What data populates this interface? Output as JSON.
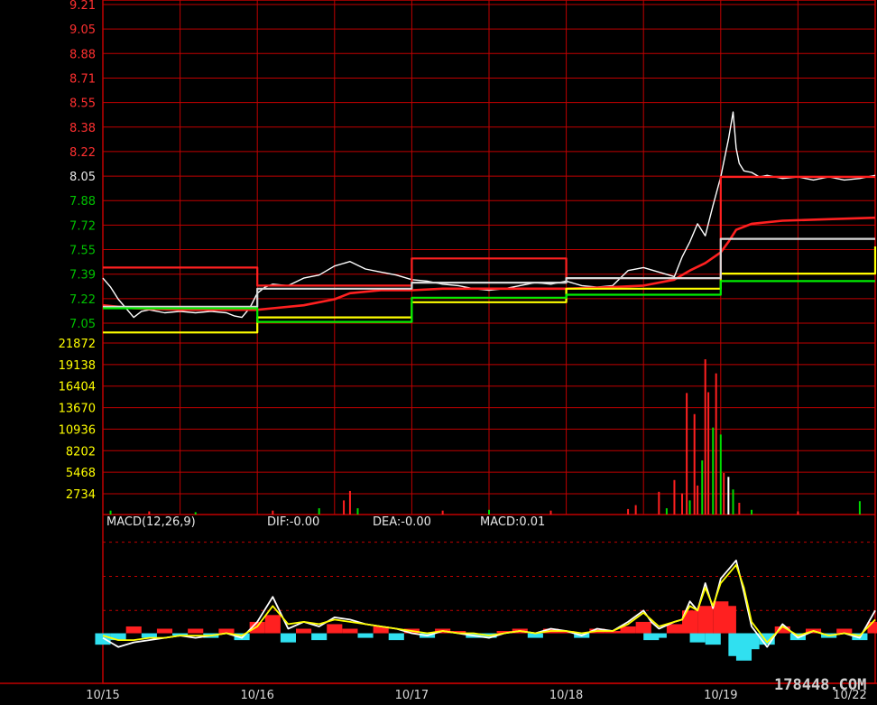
{
  "chart_data": [
    {
      "type": "line",
      "panel": "price",
      "ylim": [
        6.95,
        9.21
      ],
      "y_ticks": [
        "9.21",
        "9.05",
        "8.88",
        "8.71",
        "8.55",
        "8.38",
        "8.22",
        "8.05",
        "7.88",
        "7.72",
        "7.55",
        "7.39",
        "7.22",
        "7.05"
      ],
      "x_categories": [
        "10/15",
        "10/16",
        "10/17",
        "10/18",
        "10/19",
        "10/22"
      ],
      "series": [
        {
          "color": "#ffffff",
          "x": [
            0,
            0.05,
            0.1,
            0.15,
            0.2,
            0.25,
            0.3,
            0.4,
            0.5,
            0.6,
            0.7,
            0.8,
            0.85,
            0.9,
            0.95,
            1.0,
            1.05,
            1.1,
            1.2,
            1.3,
            1.4,
            1.5,
            1.6,
            1.7,
            1.8,
            1.9,
            2.0,
            2.1,
            2.2,
            2.3,
            2.4,
            2.5,
            2.6,
            2.7,
            2.8,
            2.9,
            3.0,
            3.1,
            3.2,
            3.3,
            3.4,
            3.5,
            3.6,
            3.7,
            3.75,
            3.8,
            3.85,
            3.9,
            3.95,
            4.0,
            4.05,
            4.08,
            4.1,
            4.12,
            4.15,
            4.2,
            4.25,
            4.3,
            4.4,
            4.5,
            4.6,
            4.7,
            4.8,
            4.9,
            5.0
          ],
          "values": [
            7.38,
            7.32,
            7.24,
            7.18,
            7.12,
            7.16,
            7.17,
            7.15,
            7.16,
            7.15,
            7.16,
            7.15,
            7.13,
            7.12,
            7.18,
            7.28,
            7.32,
            7.34,
            7.33,
            7.38,
            7.4,
            7.46,
            7.49,
            7.44,
            7.42,
            7.4,
            7.37,
            7.36,
            7.34,
            7.33,
            7.31,
            7.3,
            7.31,
            7.33,
            7.35,
            7.34,
            7.36,
            7.33,
            7.32,
            7.33,
            7.43,
            7.45,
            7.42,
            7.39,
            7.52,
            7.62,
            7.74,
            7.66,
            7.86,
            8.05,
            8.3,
            8.48,
            8.24,
            8.14,
            8.09,
            8.08,
            8.05,
            8.06,
            8.04,
            8.05,
            8.03,
            8.05,
            8.03,
            8.04,
            8.06
          ]
        },
        {
          "color": "#ff2020",
          "x": [
            0,
            0.2,
            0.5,
            0.8,
            1.0,
            1.1,
            1.3,
            1.5,
            1.6,
            1.8,
            2.0,
            2.2,
            2.5,
            2.8,
            3.0,
            3.3,
            3.5,
            3.7,
            3.8,
            3.9,
            4.0,
            4.05,
            4.1,
            4.2,
            4.4,
            4.7,
            5.0
          ],
          "values": [
            7.2,
            7.18,
            7.17,
            7.17,
            7.17,
            7.18,
            7.2,
            7.24,
            7.28,
            7.3,
            7.3,
            7.31,
            7.31,
            7.31,
            7.31,
            7.32,
            7.33,
            7.37,
            7.43,
            7.48,
            7.55,
            7.62,
            7.7,
            7.74,
            7.76,
            7.77,
            7.78
          ]
        },
        {
          "color": "#ffff00",
          "x": [
            0,
            1,
            1,
            2,
            2,
            3,
            3,
            4,
            4,
            5,
            5
          ],
          "values": [
            7.02,
            7.02,
            7.12,
            7.12,
            7.22,
            7.22,
            7.31,
            7.31,
            7.41,
            7.41,
            7.59
          ],
          "step": true
        },
        {
          "color": "#ff2020",
          "x": [
            0,
            1,
            1,
            2,
            2,
            3,
            3,
            4,
            4,
            5
          ],
          "values": [
            7.45,
            7.45,
            7.33,
            7.33,
            7.51,
            7.51,
            7.38,
            7.38,
            8.05,
            8.05
          ],
          "step": true
        },
        {
          "color": "#d8d8d8",
          "x": [
            0,
            1,
            1,
            2,
            2,
            3,
            3,
            4,
            4,
            5
          ],
          "values": [
            7.19,
            7.19,
            7.31,
            7.31,
            7.35,
            7.35,
            7.38,
            7.38,
            7.64,
            7.64
          ],
          "step": true
        },
        {
          "color": "#00ee00",
          "x": [
            0,
            1,
            1,
            2,
            2,
            3,
            3,
            4,
            4,
            5
          ],
          "values": [
            7.18,
            7.18,
            7.09,
            7.09,
            7.25,
            7.25,
            7.27,
            7.27,
            7.36,
            7.36
          ],
          "step": true
        }
      ]
    },
    {
      "type": "bar",
      "panel": "volume",
      "ylim": [
        0,
        21872
      ],
      "y_ticks": [
        "21872",
        "19138",
        "16404",
        "13670",
        "10936",
        "8202",
        "5468",
        "2734"
      ],
      "x": [
        0.05,
        0.3,
        0.6,
        1.1,
        1.4,
        1.56,
        1.6,
        1.65,
        2.2,
        2.5,
        2.9,
        3.4,
        3.45,
        3.6,
        3.65,
        3.7,
        3.75,
        3.78,
        3.8,
        3.83,
        3.85,
        3.88,
        3.9,
        3.92,
        3.95,
        3.97,
        4.0,
        4.02,
        4.05,
        4.08,
        4.12,
        4.2,
        4.5,
        4.9
      ],
      "values": [
        500,
        400,
        300,
        500,
        800,
        1800,
        3000,
        800,
        500,
        600,
        500,
        700,
        1200,
        2900,
        800,
        4400,
        2700,
        15500,
        1800,
        12800,
        3700,
        6900,
        19800,
        15600,
        11100,
        18000,
        10200,
        5300,
        4800,
        3200,
        1500,
        600,
        400,
        1700
      ],
      "colors": [
        "#00dd00",
        "#ff2020",
        "#00dd00",
        "#ff2020",
        "#00dd00",
        "#ff2020",
        "#ff2020",
        "#00dd00",
        "#ff2020",
        "#00dd00",
        "#ff2020",
        "#ff2020",
        "#ff2020",
        "#ff2020",
        "#00dd00",
        "#ff2020",
        "#ff2020",
        "#ff2020",
        "#00dd00",
        "#ff2020",
        "#ff2020",
        "#00dd00",
        "#ff2020",
        "#ff2020",
        "#00dd00",
        "#ff2020",
        "#00dd00",
        "#ff2020",
        "#ffffff",
        "#00dd00",
        "#ff2020",
        "#00dd00",
        "#ff2020",
        "#00dd00"
      ]
    },
    {
      "type": "line",
      "panel": "macd",
      "title": "MACD(12,26,9)",
      "labels": {
        "dif": "DIF:-0.00",
        "dea": "DEA:-0.00",
        "macd": "MACD:0.01"
      },
      "ylim": [
        -0.2,
        0.45
      ],
      "x": [
        0,
        0.1,
        0.2,
        0.3,
        0.4,
        0.5,
        0.6,
        0.7,
        0.8,
        0.9,
        1.0,
        1.1,
        1.2,
        1.3,
        1.4,
        1.5,
        1.6,
        1.7,
        1.8,
        1.9,
        2.0,
        2.1,
        2.2,
        2.3,
        2.4,
        2.5,
        2.6,
        2.7,
        2.8,
        2.9,
        3.0,
        3.1,
        3.2,
        3.3,
        3.4,
        3.5,
        3.55,
        3.6,
        3.7,
        3.75,
        3.8,
        3.85,
        3.9,
        3.95,
        4.0,
        4.05,
        4.1,
        4.15,
        4.2,
        4.3,
        4.4,
        4.5,
        4.6,
        4.7,
        4.8,
        4.9,
        5.0
      ],
      "series": [
        {
          "name": "DIF",
          "color": "#ffffff",
          "values": [
            -0.02,
            -0.06,
            -0.04,
            -0.03,
            -0.02,
            -0.01,
            -0.02,
            -0.01,
            0,
            -0.02,
            0.05,
            0.16,
            0.02,
            0.05,
            0.03,
            0.07,
            0.06,
            0.04,
            0.03,
            0.02,
            0.0,
            -0.01,
            0.01,
            0.0,
            -0.01,
            -0.02,
            0.0,
            0.01,
            0.0,
            0.02,
            0.01,
            -0.01,
            0.02,
            0.01,
            0.05,
            0.1,
            0.05,
            0.02,
            0.05,
            0.06,
            0.14,
            0.1,
            0.22,
            0.11,
            0.24,
            0.28,
            0.32,
            0.18,
            0.03,
            -0.06,
            0.04,
            -0.02,
            0.01,
            -0.01,
            0.0,
            -0.02,
            0.1
          ]
        },
        {
          "name": "DEA",
          "color": "#ffff00",
          "values": [
            -0.01,
            -0.03,
            -0.03,
            -0.02,
            -0.02,
            -0.01,
            -0.01,
            -0.01,
            0,
            -0.01,
            0.03,
            0.12,
            0.04,
            0.05,
            0.04,
            0.06,
            0.05,
            0.04,
            0.03,
            0.02,
            0.01,
            0.0,
            0.01,
            0.0,
            0.0,
            -0.01,
            0.0,
            0.01,
            0.0,
            0.01,
            0.01,
            0.0,
            0.01,
            0.01,
            0.04,
            0.09,
            0.06,
            0.03,
            0.05,
            0.06,
            0.12,
            0.1,
            0.2,
            0.12,
            0.22,
            0.26,
            0.3,
            0.2,
            0.05,
            -0.04,
            0.03,
            -0.01,
            0.01,
            -0.01,
            0.0,
            -0.01,
            0.06
          ]
        }
      ],
      "hist": [
        -0.05,
        -0.03,
        0.03,
        -0.02,
        0.02,
        -0.01,
        0.02,
        -0.02,
        0.02,
        -0.03,
        0.05,
        0.08,
        -0.04,
        0.02,
        -0.03,
        0.04,
        0.02,
        -0.02,
        0.03,
        -0.03,
        0.02,
        -0.02,
        0.02,
        0.01,
        -0.02,
        -0.02,
        0.01,
        0.02,
        -0.02,
        0.02,
        0.01,
        -0.02,
        0.02,
        0.01,
        0.03,
        0.05,
        -0.03,
        -0.02,
        0.04,
        0.02,
        0.1,
        -0.04,
        0.12,
        -0.05,
        0.14,
        0.12,
        -0.1,
        -0.12,
        -0.07,
        -0.05,
        0.03,
        -0.03,
        0.02,
        -0.02,
        0.02,
        -0.03,
        0.05
      ]
    }
  ],
  "watermark": "178448.COM",
  "colors": {
    "grid": "#c00000",
    "price_up": "#ff3030",
    "price_down": "#00c000",
    "volume_tick": "#ffff00",
    "hist_pos": "#ff2020",
    "hist_neg": "#30e0f0"
  }
}
